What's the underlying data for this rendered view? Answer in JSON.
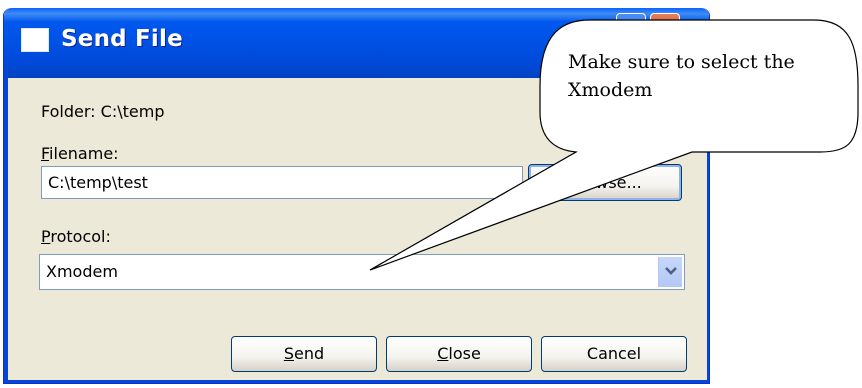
{
  "window": {
    "title": "Send File",
    "icon": "window-icon"
  },
  "form": {
    "folder_label": "Folder:",
    "folder_value": "C:\\temp",
    "filename_label_first": "F",
    "filename_label_rest": "ilename:",
    "filename_value": "C:\\temp\\test",
    "browse_label": "Browse...",
    "protocol_label_first": "P",
    "protocol_label_rest": "rotocol:",
    "protocol_value": "Xmodem"
  },
  "buttons": {
    "send_first": "S",
    "send_rest": "end",
    "close_first": "C",
    "close_rest": "lose",
    "cancel_label": "Cancel"
  },
  "callout": {
    "line1": "Make sure to select the",
    "line2": "Xmodem"
  },
  "icons": {
    "dropdown": "chevron-down-icon"
  },
  "colors": {
    "titlebar": "#0051e4",
    "dialog_bg": "#ece9d8",
    "field_border": "#7f9db9"
  }
}
